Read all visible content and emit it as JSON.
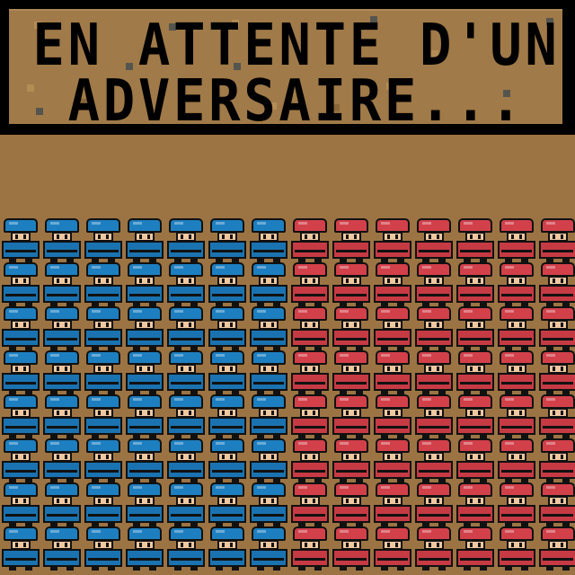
{
  "banner": {
    "line1": "EN ATTENTE D'UN",
    "line2": "ADVERSAIRE..."
  },
  "armies": {
    "blue": {
      "name": "",
      "color": "#1a73b0",
      "columns": 7,
      "rows": 8
    },
    "red": {
      "name": "",
      "color": "#c63a44",
      "columns": 7,
      "rows": 8
    }
  },
  "colors": {
    "ground": "#9c7443",
    "banner_panel": "#a07a48",
    "outline": "#000000"
  }
}
